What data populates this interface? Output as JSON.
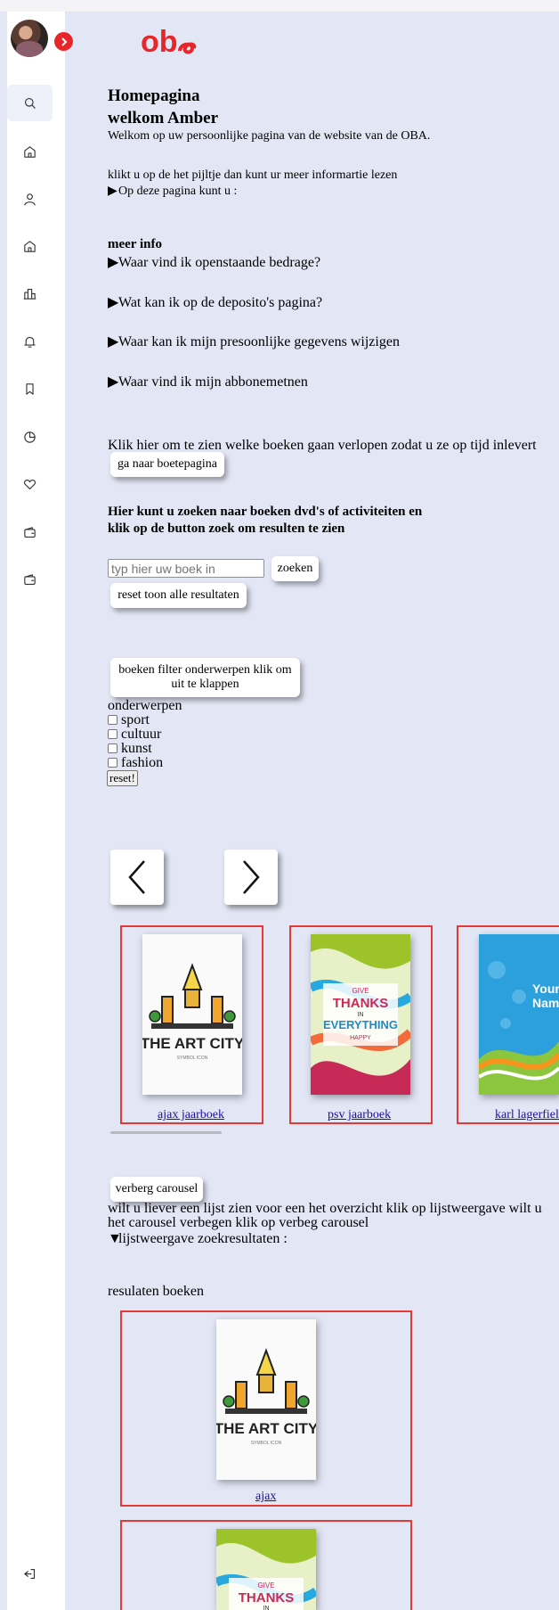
{
  "header": {
    "logo_text": "oba"
  },
  "sidebar": {
    "toggle_icon": "chevron-right-icon",
    "items": [
      {
        "icon": "search-icon",
        "label": "Zoeken"
      },
      {
        "icon": "home-icon",
        "label": "Home"
      },
      {
        "icon": "user-icon",
        "label": "Profiel"
      },
      {
        "icon": "home-icon",
        "label": "Home"
      },
      {
        "icon": "library-icon",
        "label": "Bibliotheek"
      },
      {
        "icon": "bell-icon",
        "label": "Meldingen"
      },
      {
        "icon": "bookmark-icon",
        "label": "Bladwijzers"
      },
      {
        "icon": "clock-icon",
        "label": "Historie"
      },
      {
        "icon": "heart-icon",
        "label": "Favorieten"
      },
      {
        "icon": "wallet-icon",
        "label": "Portemonnee"
      },
      {
        "icon": "wallet-icon",
        "label": "Portemonnee"
      }
    ],
    "logout_icon": "logout-icon"
  },
  "page": {
    "title": "Homepagina",
    "welcome": "welkom Amber",
    "intro": "Welkom op uw persoonlijke pagina van de website van de OBA.",
    "hint": "klikt u op de het pijltje dan kunt ur meer informartie lezen",
    "details_summary": "Op deze pagina kunt u :"
  },
  "meer_info": {
    "heading": "meer info",
    "items": [
      "Waar vind ik openstaande bedrage?",
      "Wat kan ik op de deposito's pagina?",
      "Waar kan ik mijn presoonlijke gegevens wijzigen",
      "Waar vind ik mijn abbonemetnen"
    ]
  },
  "boete": {
    "text": "Klik hier om te zien welke boeken gaan verlopen zodat u ze op tijd inlevert",
    "button": "ga naar boetepagina"
  },
  "search": {
    "heading": "Hier kunt u zoeken naar boeken dvd's of activiteiten en klik op de button zoek om resulten te zien",
    "placeholder": "typ hier uw boek in",
    "button": "zoeken",
    "reset_button": "reset toon alle resultaten"
  },
  "filter": {
    "button": "boeken filter onderwerpen klik om uit te klappen",
    "legend": "onderwerpen",
    "options": [
      "sport",
      "cultuur",
      "kunst",
      "fashion"
    ],
    "reset": "reset!"
  },
  "carousel": {
    "prev_icon": "chevron-left-icon",
    "next_icon": "chevron-right-icon",
    "items": [
      {
        "title": "ajax jaarboek",
        "cover": "THE ART CITY"
      },
      {
        "title": "psv jaarboek",
        "cover": "GIVE THANKS IN EVERYTHING"
      },
      {
        "title": "karl lagerfield",
        "cover": "Your Name"
      }
    ],
    "hide_button": "verberg carousel",
    "info": "wilt u liever een lijst zien voor een het overzicht klik op lijstweergave wilt u het carousel verbegen klik op verbeg carousel",
    "list_summary": "lijstweergave zoekresultaten :"
  },
  "results": {
    "heading": "resulaten boeken",
    "items": [
      {
        "title": "ajax",
        "cover": "THE ART CITY"
      },
      {
        "title": "",
        "cover": "GIVE THANKS IN"
      }
    ]
  },
  "covers": {
    "art_city": {
      "line1": "THE ART CITY",
      "line2": "SYMBOL ICON"
    },
    "thanks": {
      "l1": "GIVE",
      "l2": "THANKS",
      "l3": "IN",
      "l4": "EVERYTHING",
      "l5": "HAPPY"
    },
    "your_name": {
      "l1": "Your",
      "l2": "Name"
    }
  }
}
